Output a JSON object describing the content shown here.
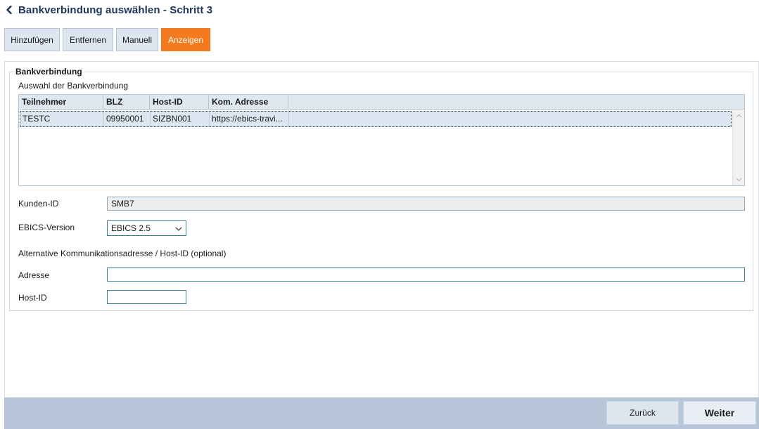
{
  "header": {
    "title": "Bankverbindung auswählen - Schritt 3"
  },
  "toolbar": {
    "buttons": [
      {
        "label": "Hinzufügen",
        "active": false
      },
      {
        "label": "Entfernen",
        "active": false
      },
      {
        "label": "Manuell",
        "active": false
      },
      {
        "label": "Anzeigen",
        "active": true
      }
    ]
  },
  "bankverbindung": {
    "legend": "Bankverbindung",
    "selection_label": "Auswahl der Bankverbindung",
    "table": {
      "columns": [
        "Teilnehmer",
        "BLZ",
        "Host-ID",
        "Kom. Adresse"
      ],
      "rows": [
        {
          "teilnehmer": "TESTC",
          "blz": "09950001",
          "host_id": "SIZBN001",
          "kom_adresse": "https://ebics-travi...",
          "selected": true
        }
      ]
    },
    "kunden_id": {
      "label": "Kunden-ID",
      "value": "SMB7"
    },
    "ebics_version": {
      "label": "EBICS-Version",
      "value": "EBICS 2.5"
    },
    "alternative_heading": "Alternative Kommunikationsadresse / Host-ID (optional)",
    "adresse": {
      "label": "Adresse",
      "value": ""
    },
    "host_id": {
      "label": "Host-ID",
      "value": ""
    }
  },
  "footer": {
    "back_label": "Zurück",
    "next_label": "Weiter"
  },
  "colors": {
    "accent": "#f47a1f",
    "title": "#1d3557",
    "footer_bar": "#b6c6d8",
    "selected_row": "#dbe6f1"
  }
}
